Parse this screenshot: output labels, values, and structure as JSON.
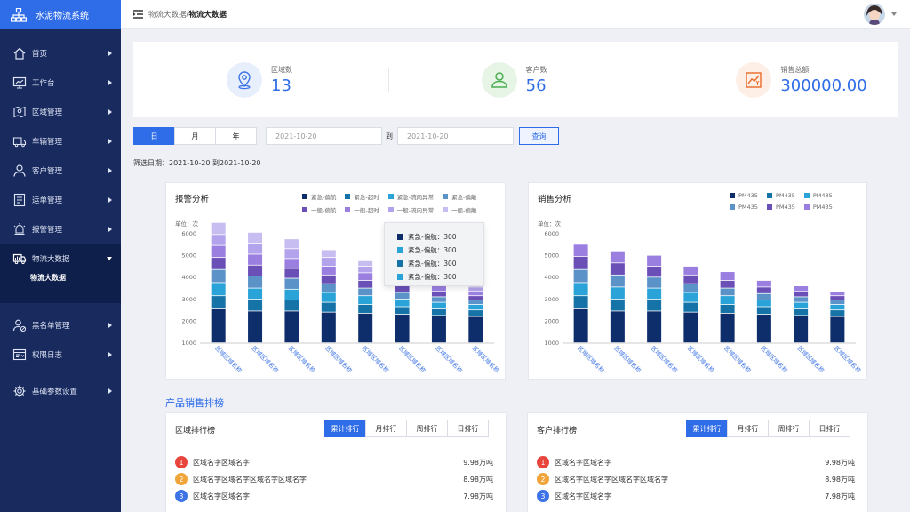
{
  "app": {
    "title": "水泥物流系统"
  },
  "sidebar": {
    "items": [
      {
        "label": "首页",
        "icon": "home-icon"
      },
      {
        "label": "工作台",
        "icon": "monitor-icon"
      },
      {
        "label": "区域管理",
        "icon": "map-pin-icon"
      },
      {
        "label": "车辆管理",
        "icon": "truck-icon"
      },
      {
        "label": "客户管理",
        "icon": "user-icon"
      },
      {
        "label": "运单管理",
        "icon": "list-icon"
      },
      {
        "label": "报警管理",
        "icon": "alarm-icon"
      },
      {
        "label": "物流大数据",
        "icon": "data-truck-icon",
        "open": true,
        "children": [
          "物流大数据"
        ]
      },
      {
        "label": "黑名单管理",
        "icon": "user-block-icon"
      },
      {
        "label": "权限日志",
        "icon": "log-icon"
      },
      {
        "label": "基础参数设置",
        "icon": "gear-icon"
      }
    ]
  },
  "header": {
    "crumb_parent": "物流大数据",
    "crumb_sep": "/",
    "crumb_current": "物流大数据"
  },
  "stats": [
    {
      "label": "区域数",
      "value": "13",
      "icon": "location-icon",
      "bg": "#e8effc",
      "color": "#3d73e6"
    },
    {
      "label": "客户数",
      "value": "56",
      "icon": "customer-icon",
      "bg": "#e7f5e6",
      "color": "#4caf50"
    },
    {
      "label": "销售总额",
      "value": "300000.00",
      "icon": "sales-chart-icon",
      "bg": "#fdeee6",
      "color": "#e86a2a"
    }
  ],
  "filter": {
    "periods": [
      "日",
      "月",
      "年"
    ],
    "active_period": "日",
    "start_date": "2021-10-20",
    "to_label": "到",
    "end_date": "2021-10-20",
    "query_label": "查询",
    "filter_text": "筛选日期：2021-10-20 到2021-10-20"
  },
  "alarm_panel": {
    "title": "报警分析",
    "unit": "单位：次",
    "legend": [
      {
        "name": "紧急-偏航",
        "color": "#0d2d6b"
      },
      {
        "name": "紧急-超时",
        "color": "#1573a8"
      },
      {
        "name": "紧急-流向异常",
        "color": "#2aa3d8"
      },
      {
        "name": "紧急-偏離",
        "color": "#5b93c9"
      },
      {
        "name": "一般-偏航",
        "color": "#6a4fb7"
      },
      {
        "name": "一般-超时",
        "color": "#9a7ee0"
      },
      {
        "name": "一般-流向异常",
        "color": "#b3a3ec"
      },
      {
        "name": "一般-偏離",
        "color": "#c7bdf0"
      }
    ],
    "tooltip": [
      {
        "text": "紧急-偏航：300",
        "color": "#0d2d6b"
      },
      {
        "text": "紧急-偏航：300",
        "color": "#2aa3d8"
      },
      {
        "text": "紧急-偏航：300",
        "color": "#1573a8"
      },
      {
        "text": "紧急-偏航：300",
        "color": "#2aa3d8"
      }
    ]
  },
  "sales_panel": {
    "title": "销售分析",
    "legend": [
      {
        "name": "PM435",
        "color": "#0d2d6b"
      },
      {
        "name": "PM435",
        "color": "#1573a8"
      },
      {
        "name": "PM435",
        "color": "#2aa3d8"
      },
      {
        "name": "PM435",
        "color": "#5b93c9"
      },
      {
        "name": "PM435",
        "color": "#6a4fb7"
      },
      {
        "name": "PM435",
        "color": "#9a7ee0"
      }
    ]
  },
  "chart_data": [
    {
      "type": "bar",
      "stacked": true,
      "categories": [
        "区域区域名称",
        "区域区域名称",
        "区域区域名称",
        "区域区域名称",
        "区域区域名称",
        "区域区域名称",
        "区域区域名称",
        "区域区域名称"
      ],
      "ylim": [
        1000,
        6000
      ],
      "yticks": [
        1000,
        2000,
        3000,
        4000,
        5000,
        6000
      ],
      "series": [
        {
          "name": "紧急-偏航",
          "color": "#0d2d6b",
          "values": [
            1550,
            1450,
            1450,
            1400,
            1350,
            1300,
            1250,
            1200
          ]
        },
        {
          "name": "紧急-超时",
          "color": "#1573a8",
          "values": [
            600,
            550,
            500,
            450,
            400,
            350,
            300,
            300
          ]
        },
        {
          "name": "紧急-流向异常",
          "color": "#2aa3d8",
          "values": [
            600,
            500,
            500,
            450,
            400,
            350,
            300,
            250
          ]
        },
        {
          "name": "紧急-偏離",
          "color": "#5b93c9",
          "values": [
            600,
            550,
            500,
            400,
            350,
            300,
            250,
            200
          ]
        },
        {
          "name": "一般-偏航",
          "color": "#6a4fb7",
          "values": [
            550,
            500,
            450,
            400,
            350,
            300,
            250,
            200
          ]
        },
        {
          "name": "一般-超时",
          "color": "#9a7ee0",
          "values": [
            550,
            500,
            450,
            400,
            350,
            250,
            250,
            200
          ]
        },
        {
          "name": "一般-流向异常",
          "color": "#b3a3ec",
          "values": [
            500,
            500,
            450,
            400,
            300,
            300,
            250,
            200
          ]
        },
        {
          "name": "一般-偏離",
          "color": "#c7bdf0",
          "values": [
            550,
            500,
            450,
            350,
            250,
            250,
            200,
            200
          ]
        }
      ]
    },
    {
      "type": "bar",
      "stacked": true,
      "categories": [
        "区域区域名称",
        "区域区域名称",
        "区域区域名称",
        "区域区域名称",
        "区域区域名称",
        "区域区域名称",
        "区域区域名称",
        "区域区域名称"
      ],
      "ylim": [
        1000,
        6000
      ],
      "yticks": [
        1000,
        2000,
        3000,
        4000,
        5000,
        6000
      ],
      "series": [
        {
          "name": "PM435",
          "color": "#0d2d6b",
          "values": [
            1550,
            1450,
            1450,
            1400,
            1350,
            1300,
            1250,
            1200
          ]
        },
        {
          "name": "PM435",
          "color": "#1573a8",
          "values": [
            600,
            550,
            550,
            450,
            400,
            350,
            300,
            300
          ]
        },
        {
          "name": "PM435",
          "color": "#2aa3d8",
          "values": [
            600,
            550,
            500,
            450,
            400,
            300,
            300,
            250
          ]
        },
        {
          "name": "PM435",
          "color": "#5b93c9",
          "values": [
            600,
            550,
            500,
            400,
            350,
            300,
            250,
            200
          ]
        },
        {
          "name": "PM435",
          "color": "#6a4fb7",
          "values": [
            600,
            550,
            500,
            400,
            350,
            300,
            250,
            200
          ]
        },
        {
          "name": "PM435",
          "color": "#9a7ee0",
          "values": [
            550,
            550,
            500,
            400,
            400,
            300,
            250,
            200
          ]
        }
      ]
    }
  ],
  "ranking": {
    "section_title": "产品销售排榜",
    "tabs": [
      "累计排行",
      "月排行",
      "周排行",
      "日排行"
    ],
    "active_tab": "累计排行",
    "rank_colors": [
      "#e8453c",
      "#f0a43a",
      "#3d73e6",
      "#bbbbbb"
    ],
    "region": {
      "title": "区域排行榜",
      "rows": [
        {
          "no": "1",
          "name": "区域名字区域名字",
          "value": "9.98万吨"
        },
        {
          "no": "2",
          "name": "区域名字区域名字区域名字区域名字",
          "value": "8.98万吨"
        },
        {
          "no": "3",
          "name": "区域名字区域名字",
          "value": "7.98万吨"
        }
      ]
    },
    "customer": {
      "title": "客户排行榜",
      "rows": [
        {
          "no": "1",
          "name": "区域名字区域名字",
          "value": "9.98万吨"
        },
        {
          "no": "2",
          "name": "区域名字区域名字区域名字区域名字",
          "value": "8.98万吨"
        },
        {
          "no": "3",
          "name": "区域名字区域名字",
          "value": "7.98万吨"
        }
      ]
    }
  }
}
